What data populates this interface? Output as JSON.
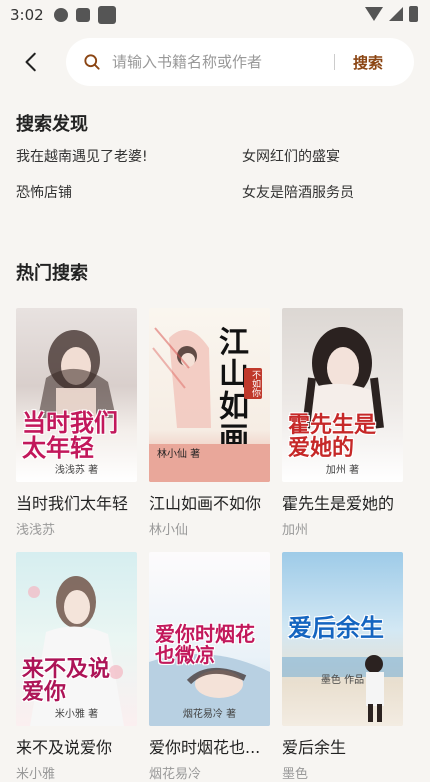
{
  "status_bar": {
    "time": "3:02"
  },
  "search": {
    "placeholder": "请输入书籍名称或作者",
    "button_label": "搜索"
  },
  "discover": {
    "title": "搜索发现",
    "items": [
      "我在越南遇见了老婆!",
      "女网红们的盛宴",
      "恐怖店铺",
      "女友是陪酒服务员"
    ]
  },
  "hot": {
    "title": "热门搜索",
    "books": [
      {
        "title": "当时我们太年轻",
        "author": "浅浅苏",
        "cover_title": "当时我们太年轻",
        "cover_author": "浅浅苏 著",
        "cover_color": "#c2185b"
      },
      {
        "title": "江山如画不如你",
        "author": "林小仙",
        "cover_title": "江山如画",
        "cover_seal": "不如你",
        "cover_author": "林小仙 著",
        "cover_color": "#111111"
      },
      {
        "title": "霍先生是爱她的",
        "author": "加州",
        "cover_title": "霍先生是爱她的",
        "cover_author": "加州 著",
        "cover_color": "#c62828"
      },
      {
        "title": "来不及说爱你",
        "author": "米小雅",
        "cover_title": "来不及说爱你",
        "cover_author": "米小雅 著",
        "cover_color": "#ad1457"
      },
      {
        "title": "爱你时烟花也...",
        "author": "烟花易冷",
        "cover_title": "爱你时烟花也微凉",
        "cover_author": "烟花易冷 著",
        "cover_color": "#c2185b"
      },
      {
        "title": "爱后余生",
        "author": "墨色",
        "cover_title": "爱后余生",
        "cover_author": "墨色 作品",
        "cover_color": "#1565c0"
      }
    ]
  }
}
